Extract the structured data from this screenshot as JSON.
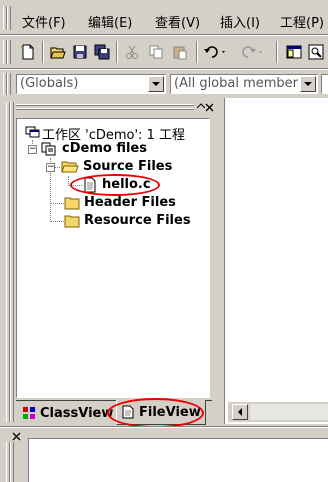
{
  "menu": {
    "items": [
      "文件(F)",
      "编辑(E)",
      "查看(V)",
      "插入(I)",
      "工程(P)"
    ]
  },
  "toolbar": {
    "buttons": [
      "new-file-icon",
      "open-icon",
      "save-icon",
      "save-all-icon",
      "cut-icon",
      "copy-icon",
      "paste-icon",
      "undo-icon",
      "redo-icon",
      "workspace-icon",
      "find-icon"
    ]
  },
  "combos": {
    "globals": "(Globals)",
    "members": "(All global member"
  },
  "workspace": {
    "root_label": "工作区 'cDemo': 1 工程",
    "project_label": "cDemo files",
    "folders": {
      "source": "Source Files",
      "header": "Header Files",
      "resource": "Resource Files"
    },
    "file": "hello.c"
  },
  "tabs": {
    "classview": "ClassView",
    "fileview": "FileView"
  },
  "colors": {
    "chrome": "#d4d0c8",
    "highlight": "#e00000",
    "folder": "#f5d66b"
  }
}
